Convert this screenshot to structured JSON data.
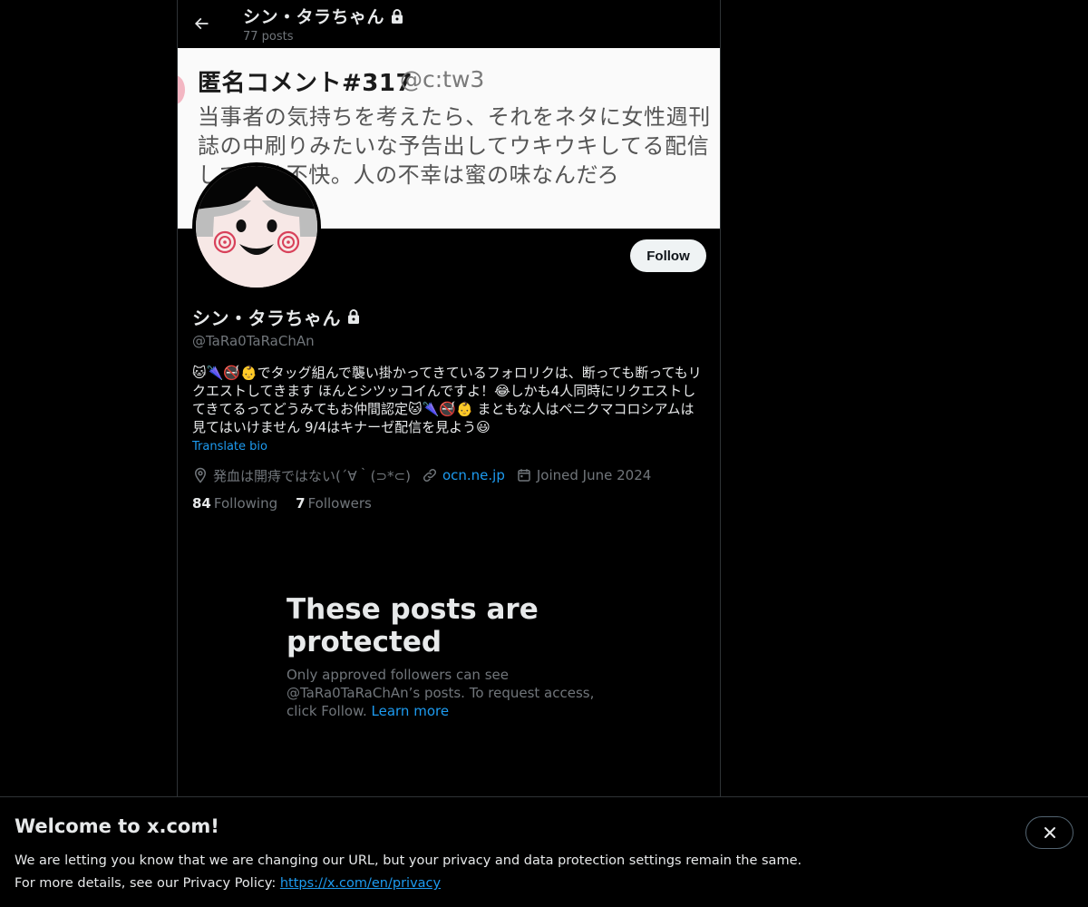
{
  "header": {
    "back_label": "back",
    "name": "シン・タラちゃん",
    "posts_count": "77 posts"
  },
  "banner": {
    "heading": "匿名コメント#317",
    "handle": "@c:tw3",
    "body": "当事者の気持ちを考えたら、それをネタに女性週刊誌の中刷りみたいな予告出してウキウキしてる配信して凄く不快。人の不幸は蜜の味なんだろ"
  },
  "profile": {
    "name": "シン・タラちゃん",
    "handle": "@TaRa0TaRaChAn",
    "follow_label": "Follow",
    "bio_line1": "🐱🌂🚭👶でタッグ組んで襲い掛かってきているフォロリクは、断っても断ってもリクエストしてきます ほんとシツッコイんですよ！😂しかも4人同時にリクエストしてきてるってどうみてもお仲間認定🐱🌂🚭👶 まともな人はペニクマコロシアムは見てはいけません 9/4はキナーゼ配信を見よう😃",
    "translate_label": "Translate bio",
    "location": "発血は開痔ではない(´∀｀(⊃*⊂)",
    "website": "ocn.ne.jp",
    "joined": "Joined June 2024",
    "following_count": "84",
    "following_label": "Following",
    "followers_count": "7",
    "followers_label": "Followers"
  },
  "protected": {
    "title": "These posts are protected",
    "description": "Only approved followers can see @TaRa0TaRaChAn’s posts. To request access, click Follow.",
    "learn_more": "Learn more"
  },
  "welcome": {
    "title": "Welcome to x.com!",
    "line1": "We are letting you know that we are changing our URL, but your privacy and data protection settings remain the same.",
    "line2_prefix": "For more details, see our Privacy Policy:",
    "privacy_link": "https://x.com/en/privacy"
  },
  "icons": [
    "back-arrow-icon",
    "lock-icon",
    "location-icon",
    "link-icon",
    "calendar-icon",
    "close-icon"
  ],
  "colors": {
    "accent": "#1d9bf0",
    "muted": "#71767b",
    "text": "#e7e9ea",
    "background": "#000000"
  }
}
